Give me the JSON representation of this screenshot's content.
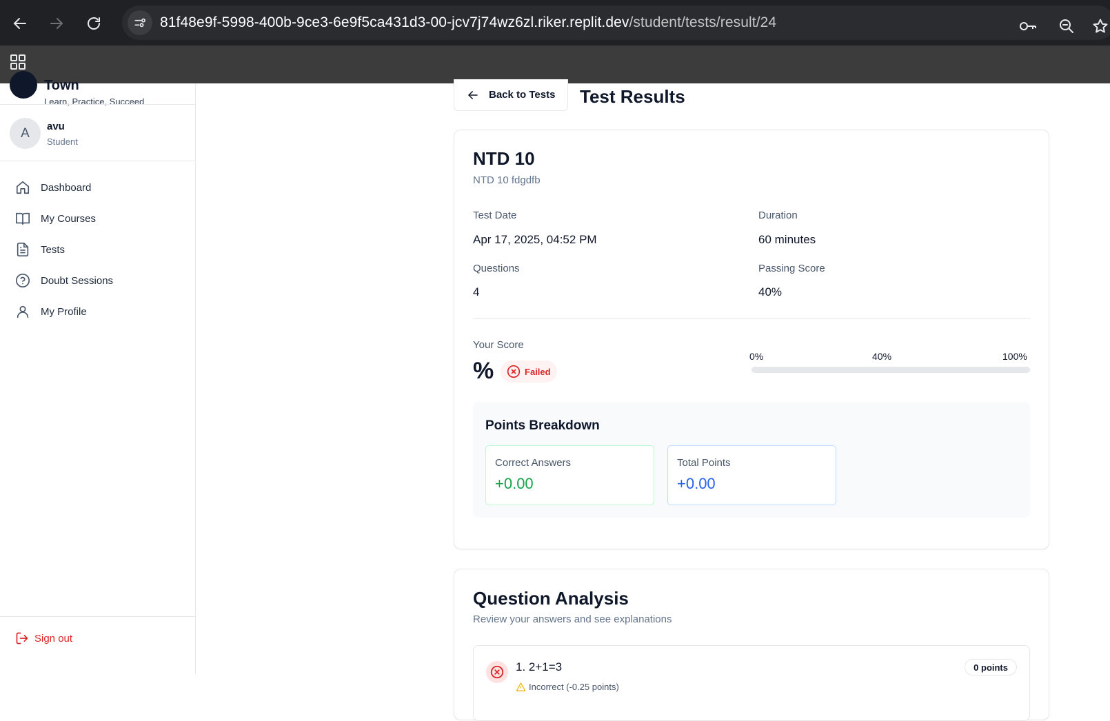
{
  "browser": {
    "url_host": "81f48e9f-5998-400b-9ce3-6e9f5ca431d3-00-jcv7j74wz6zl.riker.replit.dev",
    "url_path": "/student/tests/result/24"
  },
  "sidebar": {
    "brand_name": "Town",
    "brand_tagline": "Learn, Practice, Succeed",
    "user": {
      "initial": "A",
      "name": "avu",
      "role": "Student"
    },
    "items": [
      {
        "label": "Dashboard",
        "icon": "home-icon"
      },
      {
        "label": "My Courses",
        "icon": "book-icon"
      },
      {
        "label": "Tests",
        "icon": "file-text-icon"
      },
      {
        "label": "Doubt Sessions",
        "icon": "help-circle-icon"
      },
      {
        "label": "My Profile",
        "icon": "user-icon"
      }
    ],
    "sign_out": "Sign out"
  },
  "header": {
    "back_label": "Back to Tests",
    "title": "Test Results"
  },
  "result": {
    "test_name": "NTD 10",
    "test_description": "NTD 10 fdgdfb",
    "test_date_label": "Test Date",
    "test_date": "Apr 17, 2025, 04:52 PM",
    "duration_label": "Duration",
    "duration": "60 minutes",
    "questions_label": "Questions",
    "questions": "4",
    "passing_label": "Passing Score",
    "passing": "40%",
    "score_label": "Your Score",
    "score_value": "%",
    "status": "Failed",
    "scale": {
      "min": "0%",
      "mid": "40%",
      "max": "100%"
    },
    "progress_percent": 0,
    "breakdown": {
      "title": "Points Breakdown",
      "correct_label": "Correct Answers",
      "correct_value": "+0.00",
      "total_label": "Total Points",
      "total_value": "+0.00"
    }
  },
  "analysis": {
    "title": "Question Analysis",
    "subtitle": "Review your answers and see explanations",
    "questions": [
      {
        "text": "1. 2+1=3",
        "status": "Incorrect (-0.25 points)",
        "points": "0 points"
      }
    ]
  },
  "colors": {
    "danger": "#dc2626",
    "success": "#16a34a",
    "primary": "#2563eb"
  }
}
